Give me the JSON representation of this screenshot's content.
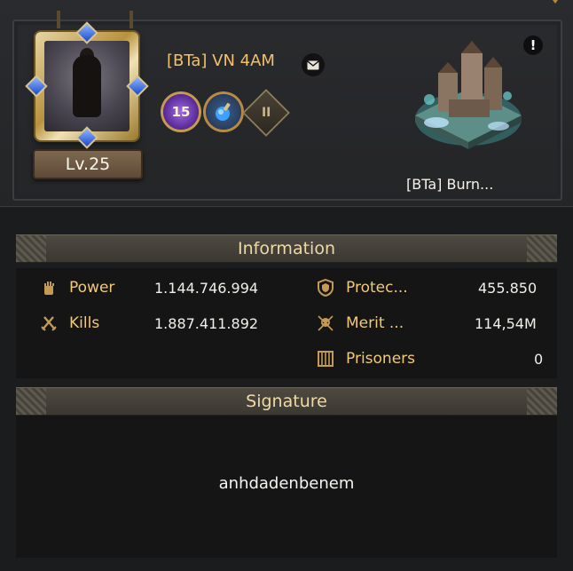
{
  "player": {
    "name": "[BTa] VN 4AM",
    "level": "Lv.25",
    "vip_level": "15",
    "rank_badge": "II"
  },
  "city": {
    "name": "[BTa] Burn..."
  },
  "information": {
    "title": "Information",
    "left": [
      {
        "label": "Power",
        "value": "1.144.746.994",
        "icon": "power-fist-icon"
      },
      {
        "label": "Kills",
        "value": "1.887.411.892",
        "icon": "crossed-swords-icon"
      }
    ],
    "right": [
      {
        "label": "Protec...",
        "value": "455.850",
        "icon": "shield-icon"
      },
      {
        "label": "Merit ...",
        "value": "114,54M",
        "icon": "merit-skull-icon"
      },
      {
        "label": "Prisoners",
        "value": "0",
        "icon": "prison-bars-icon"
      }
    ]
  },
  "signature": {
    "title": "Signature",
    "text": "anhdadenbenem"
  },
  "alert_symbol": "!",
  "colors": {
    "accent_gold": "#f0c97a",
    "name_orange": "#f1c067",
    "panel_dark": "#151516"
  }
}
